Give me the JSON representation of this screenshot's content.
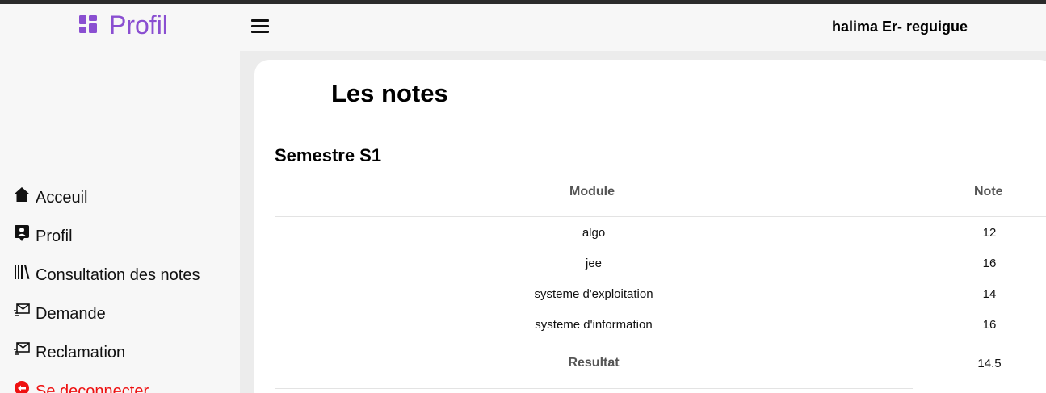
{
  "brand": {
    "title": "Profil",
    "icon": "dashboard-grid-icon",
    "color": "#8a4fd1"
  },
  "header": {
    "username": "halima Er- reguigue",
    "menu_icon": "hamburger-icon"
  },
  "sidebar": {
    "items": [
      {
        "label": "Acceuil",
        "icon": "home-icon"
      },
      {
        "label": "Profil",
        "icon": "profile-badge-icon"
      },
      {
        "label": "Consultation des notes",
        "icon": "books-icon"
      },
      {
        "label": "Demande",
        "icon": "mail-send-icon"
      },
      {
        "label": "Reclamation",
        "icon": "mail-send-icon"
      },
      {
        "label": "Se deconnecter",
        "icon": "logout-circle-icon",
        "color": "#ee1111"
      }
    ]
  },
  "main": {
    "title": "Les notes",
    "semester": "Semestre S1",
    "table": {
      "headers": {
        "module": "Module",
        "note": "Note"
      },
      "rows": [
        {
          "module": "algo",
          "note": "12"
        },
        {
          "module": "jee",
          "note": "16"
        },
        {
          "module": "systeme d'exploitation",
          "note": "14"
        },
        {
          "module": "systeme d'information",
          "note": "16"
        }
      ],
      "result": {
        "label": "Resultat",
        "value": "14.5"
      }
    }
  }
}
